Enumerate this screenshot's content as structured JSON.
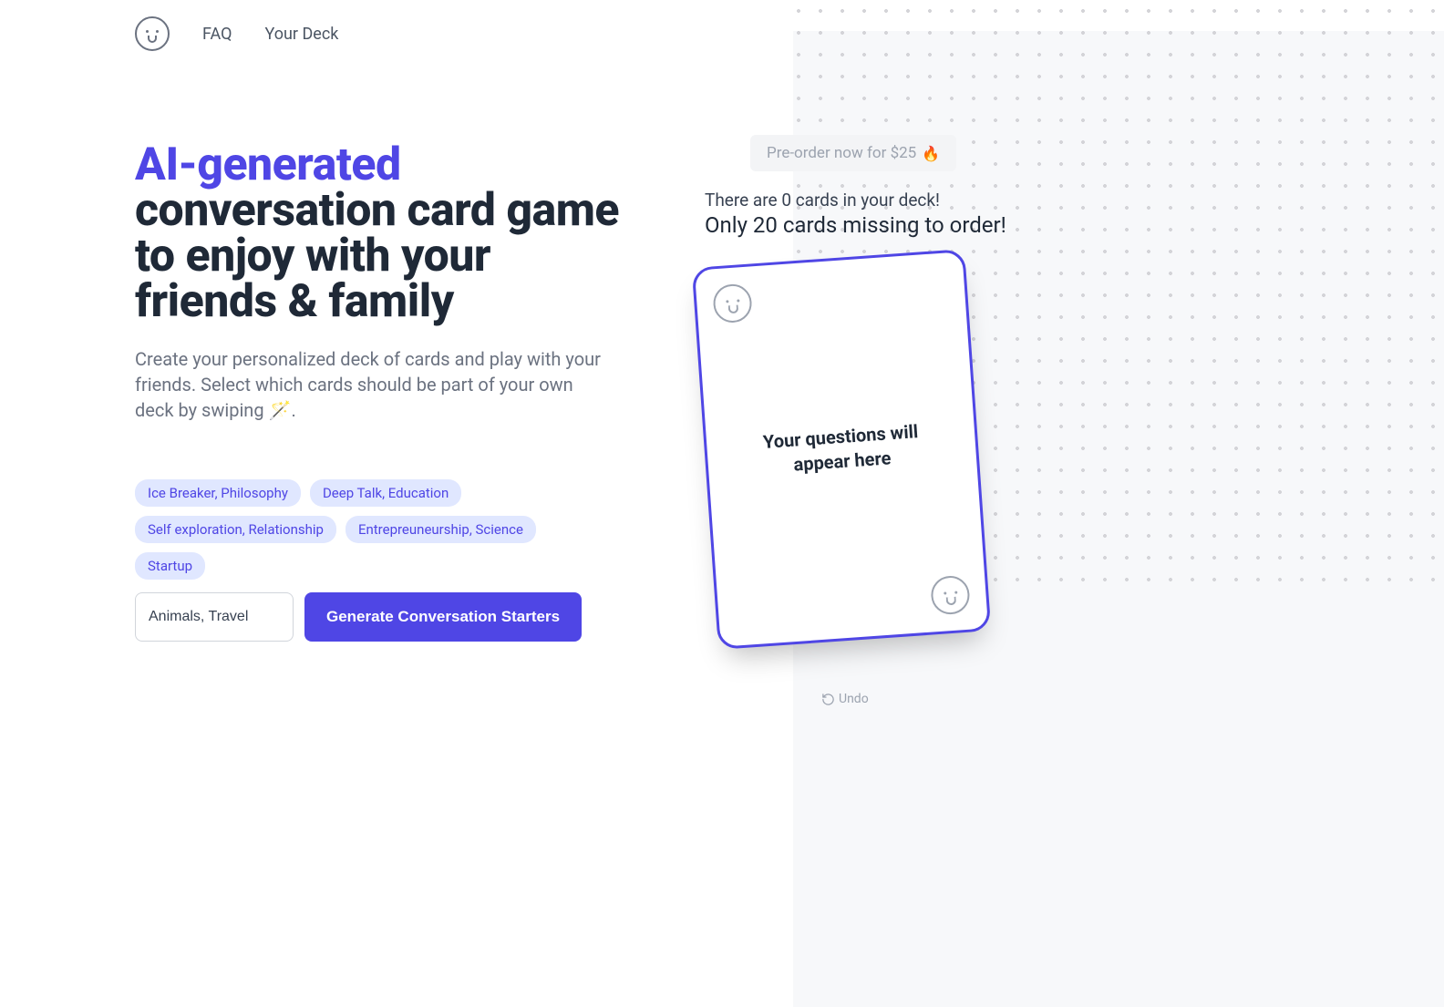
{
  "nav": {
    "links": [
      "FAQ",
      "Your Deck"
    ]
  },
  "hero": {
    "title_accent": "AI-generated",
    "title_rest": " conversation card game to enjoy with your friends & family",
    "subtitle": "Create your personalized deck of cards and play with your friends. Select which cards should be part of your own deck by swiping 🪄."
  },
  "tags": [
    "Ice Breaker, Philosophy",
    "Deep Talk, Education",
    "Self exploration, Relationship",
    "Entrepreuneurship, Science",
    "Startup"
  ],
  "input": {
    "value": "Animals, Travel",
    "button": "Generate Conversation Starters"
  },
  "preorder": {
    "label": "Pre-order now for $25",
    "emoji": "🔥"
  },
  "deck": {
    "status_line1": "There are 0 cards in your deck!",
    "status_line2": "Only 20 cards missing to order!",
    "card_placeholder": "Your questions will appear here",
    "undo_label": "Undo"
  }
}
